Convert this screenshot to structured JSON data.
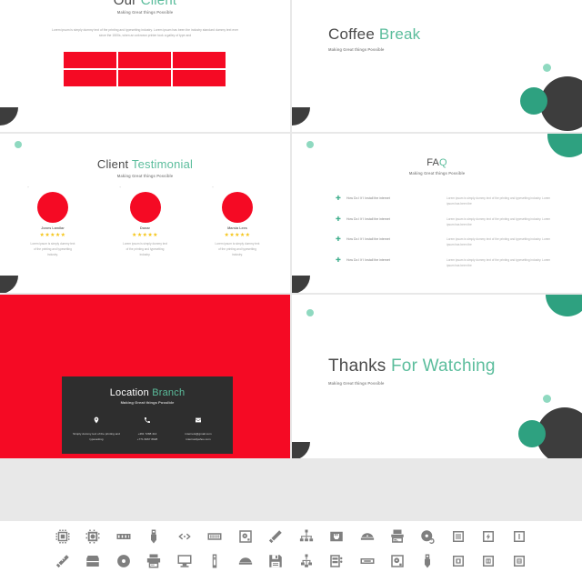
{
  "theme": {
    "red": "#f50a24",
    "green": "#2ea180",
    "mint": "#8fd9c0",
    "dark": "#3d3d3d",
    "accent_text": "#5bbd9c",
    "heading_text": "#4a4a4a"
  },
  "slides": {
    "our_client": {
      "title_main": "Our",
      "title_accent": "Client",
      "subtitle": "Making Great things Possible",
      "paragraph": "Lorem ipsum is simply dummy text of the printing and typesetting industry. Lorem ipsum has been the industry standard dummy text ever since the 1500s, when an unknown printer took a galley of type and",
      "logo_count": 6
    },
    "coffee_break": {
      "title_main": "Coffee",
      "title_accent": "Break",
      "subtitle": "Making Great things Possible"
    },
    "client_testimonial": {
      "title_main": "Client",
      "title_accent": "Testimonial",
      "subtitle": "Making Great things Possible",
      "cards": [
        {
          "name": "Jones Lamilar",
          "stars": "★★★★★",
          "text": "Lorem ipsum is simply dummy text of the printing and typesetting industry."
        },
        {
          "name": "Donar",
          "stars": "★★★★★",
          "text": "Lorem ipsum is simply dummy text of the printing and typesetting industry."
        },
        {
          "name": "Marsia Lees",
          "stars": "★★★★★",
          "text": "Lorem ipsum is simply dummy text of the printing and typesetting industry."
        }
      ]
    },
    "faq": {
      "title_main": "FA",
      "title_accent": "Q",
      "subtitle": "Making Great things Possible",
      "items": [
        {
          "question": "How Do I If I Install the internet",
          "answer": "Lorem ipsum is simply dummy text of the printing and typesetting industry. Lorem ipsum has been the"
        },
        {
          "question": "How Do I If I Install the internet",
          "answer": "Lorem ipsum is simply dummy text of the printing and typesetting industry. Lorem ipsum has been the"
        },
        {
          "question": "How Do I If I Install the internet",
          "answer": "Lorem ipsum is simply dummy text of the printing and typesetting industry. Lorem ipsum has been the"
        },
        {
          "question": "How Do I If I Install the internet",
          "answer": "Lorem ipsum is simply dummy text of the printing and typesetting industry. Lorem ipsum has been the"
        }
      ]
    },
    "location_branch": {
      "title_main": "Location",
      "title_accent": "Branch",
      "subtitle": "Making Great things Possible",
      "contacts": [
        {
          "icon": "location-pin-icon",
          "glyph": "◉",
          "value": "Simply dummy text of the printing and typesetting"
        },
        {
          "icon": "phone-icon",
          "glyph": "☎",
          "value": "+461 7288 414\n+771 8267 8928"
        },
        {
          "icon": "mail-icon",
          "glyph": "✉",
          "value": "internets@gmail.com\ninternatdyahoo.com"
        }
      ]
    },
    "thanks": {
      "title_main": "Thanks",
      "title_accent": "For Watching",
      "subtitle": "Making Great things Possible"
    }
  },
  "icon_library": {
    "row1": [
      "cpu-chip-icon",
      "processor-icon",
      "ram-module-icon",
      "usb-plug-icon",
      "code-brackets-icon",
      "keyboard-icon",
      "hard-drive-icon",
      "usb-flash-drive-icon",
      "network-hub-icon",
      "ethernet-port-icon",
      "optical-drive-slot-icon",
      "scanner-icon",
      "disc-refresh-icon",
      "chip-square-icon",
      "chip-power-icon",
      "chip-pin-icon"
    ],
    "row2": [
      "memory-stick-icon",
      "toolbox-icon",
      "compact-disc-icon",
      "printer-icon",
      "monitor-icon",
      "battery-icon",
      "external-drive-icon",
      "floppy-disk-icon",
      "network-tree-icon",
      "server-rack-icon",
      "card-reader-icon",
      "hdd-platter-icon",
      "usb-cable-icon",
      "chip-ic-icon",
      "chip-ic2-icon",
      "chip-ic3-icon"
    ]
  }
}
